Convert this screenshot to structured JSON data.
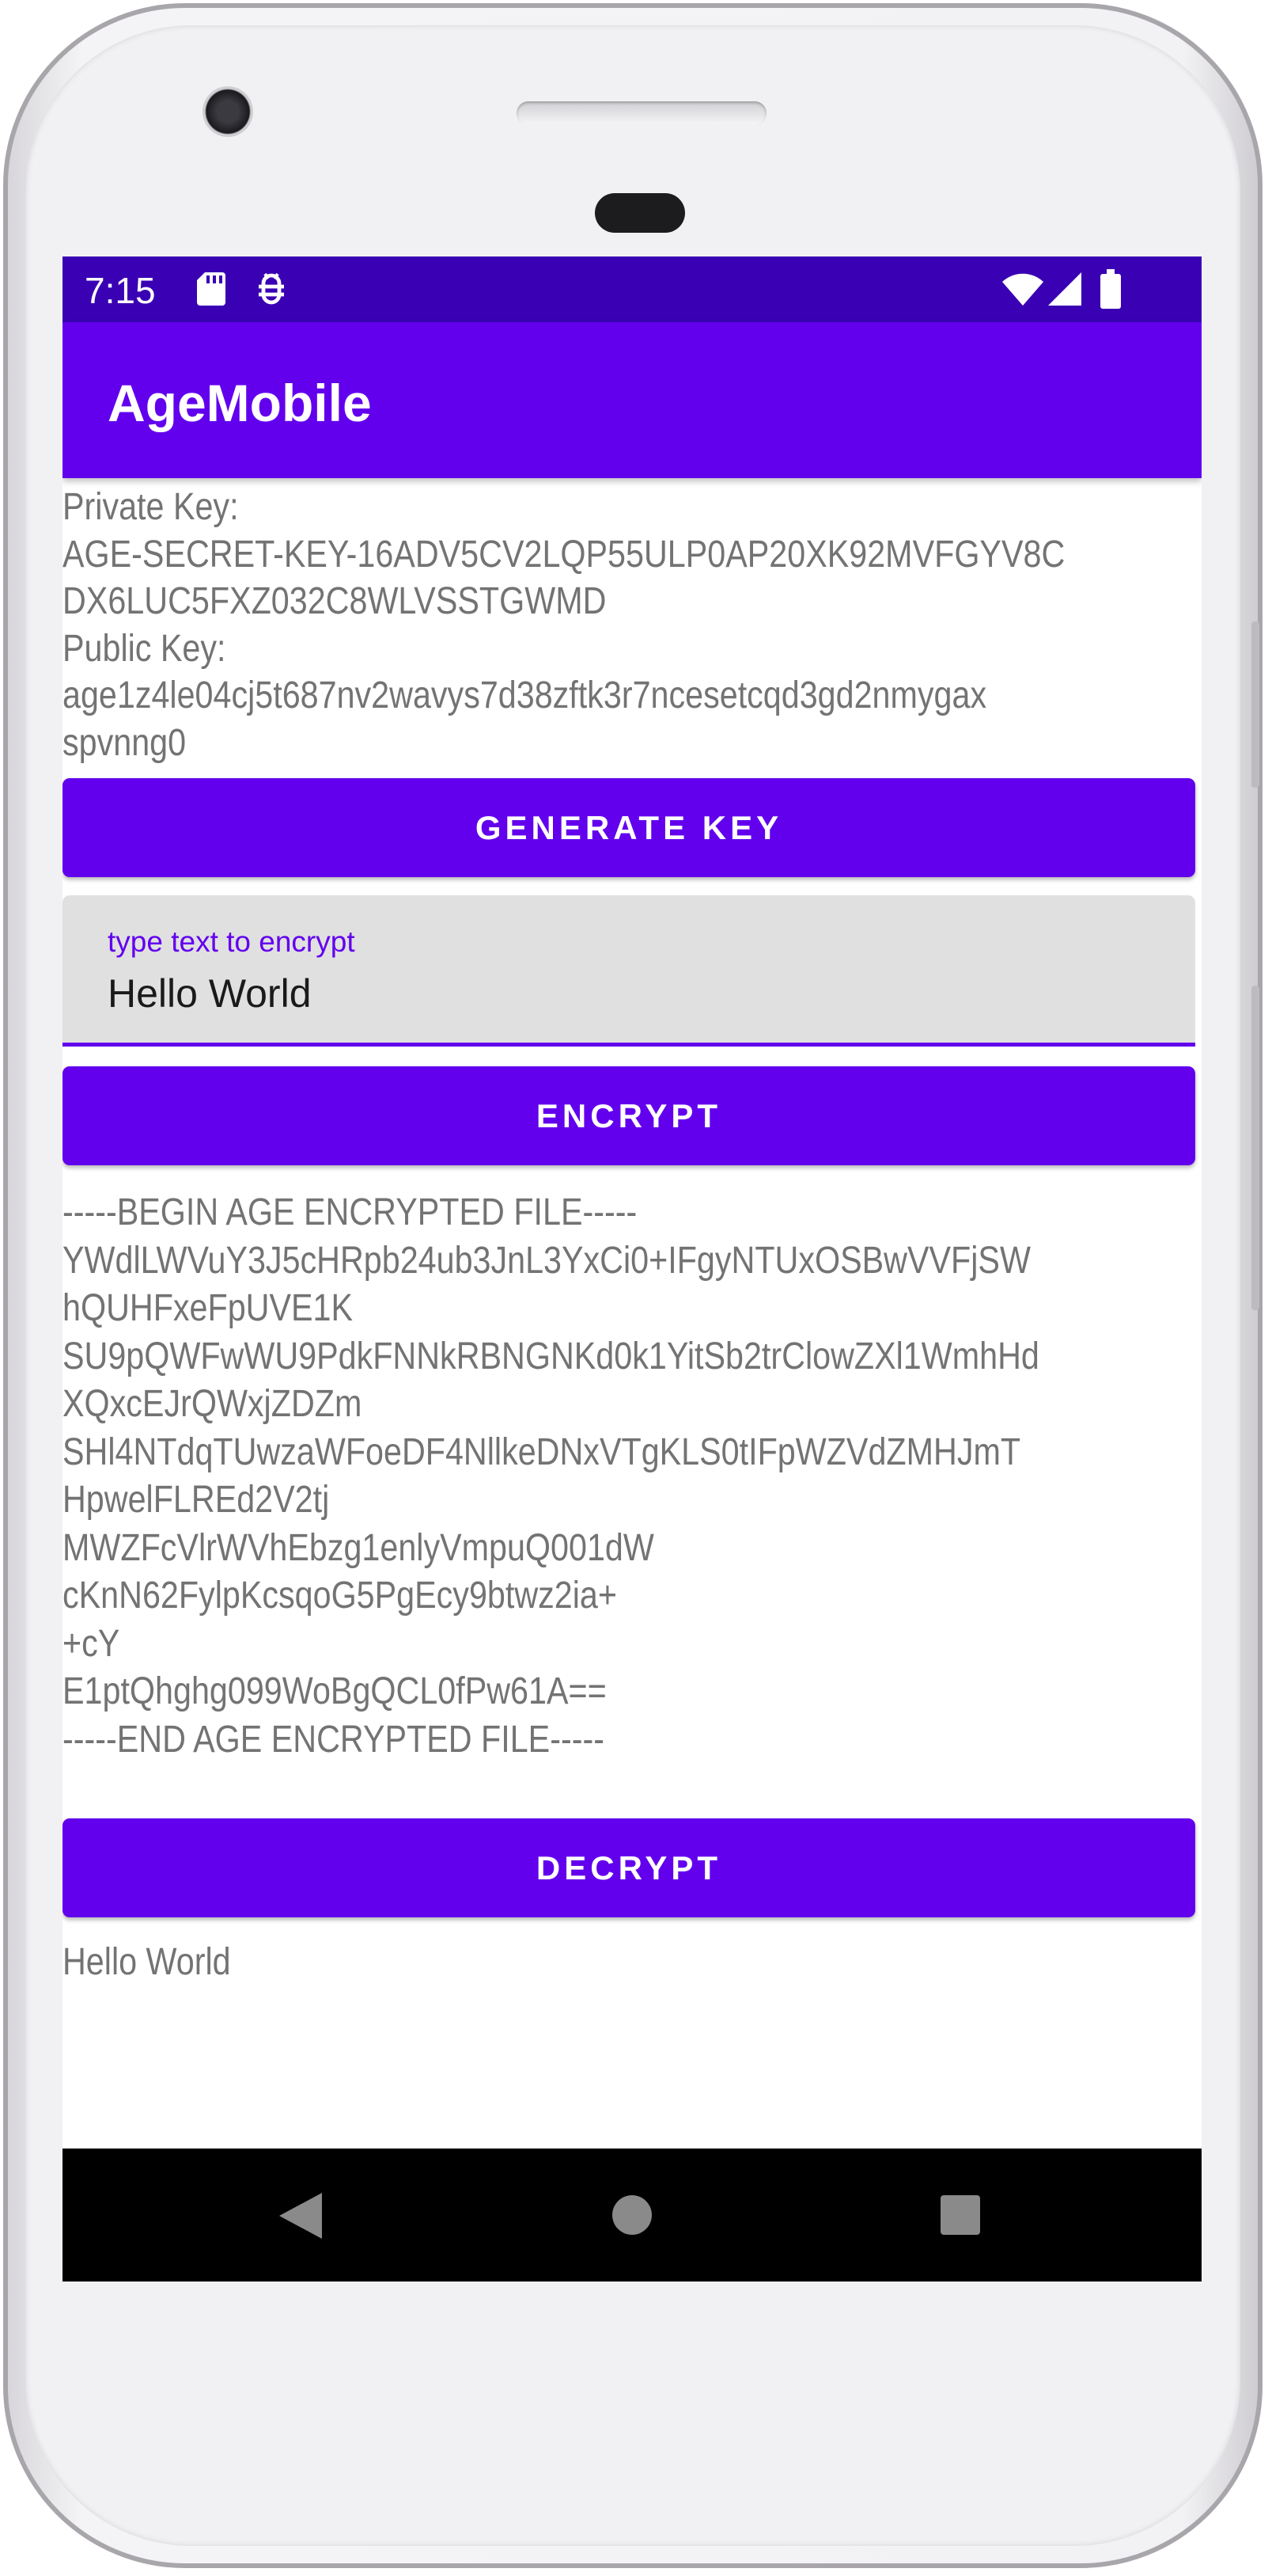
{
  "status_bar": {
    "time": "7:15",
    "icons": [
      "sd-card-icon",
      "debug-icon",
      "wifi-icon",
      "signal-icon",
      "battery-icon"
    ]
  },
  "app_bar": {
    "title": "AgeMobile"
  },
  "keys": {
    "private_label": "Private Key:",
    "private_lines": [
      "AGE-SECRET-KEY-16ADV5CV2LQP55ULP0AP20XK92MVFGYV8C",
      "DX6LUC5FXZ032C8WLVSSTGWMD"
    ],
    "public_label": "Public Key:",
    "public_lines": [
      "age1z4le04cj5t687nv2wavys7d38zftk3r7ncesetcqd3gd2nmygax",
      "spvnng0"
    ]
  },
  "buttons": {
    "generate": "GENERATE KEY",
    "encrypt": "ENCRYPT",
    "decrypt": "DECRYPT"
  },
  "input": {
    "label": "type text to encrypt",
    "value": "Hello World"
  },
  "encrypted_lines": [
    "-----BEGIN AGE ENCRYPTED FILE-----",
    "YWdlLWVuY3J5cHRpb24ub3JnL3YxCi0+IFgyNTUxOSBwVVFjSW",
    "hQUHFxeFpUVE1K",
    "SU9pQWFwWU9PdkFNNkRBNGNKd0k1YitSb2trClowZXl1WmhHd",
    "XQxcEJrQWxjZDZm",
    "SHl4NTdqTUwzaWFoeDF4NllkeDNxVTgKLS0tIFpWZVdZMHJmT",
    "HpwelFLREd2V2tj",
    "MWZFcVlrWVhEbzg1enlyVmpuQ001dW",
    "cKnN62FylpKcsqoG5PgEcy9btwz2ia+",
    "+cY",
    "E1ptQhghg099WoBgQCL0fPw61A==",
    "-----END AGE ENCRYPTED FILE-----"
  ],
  "decrypted": "Hello World",
  "nav_bar": {
    "icons": [
      "back-icon",
      "home-icon",
      "recents-icon"
    ]
  },
  "colors": {
    "primary": "#6200ee",
    "status_bar": "#3a00b4",
    "text": "#737373"
  }
}
